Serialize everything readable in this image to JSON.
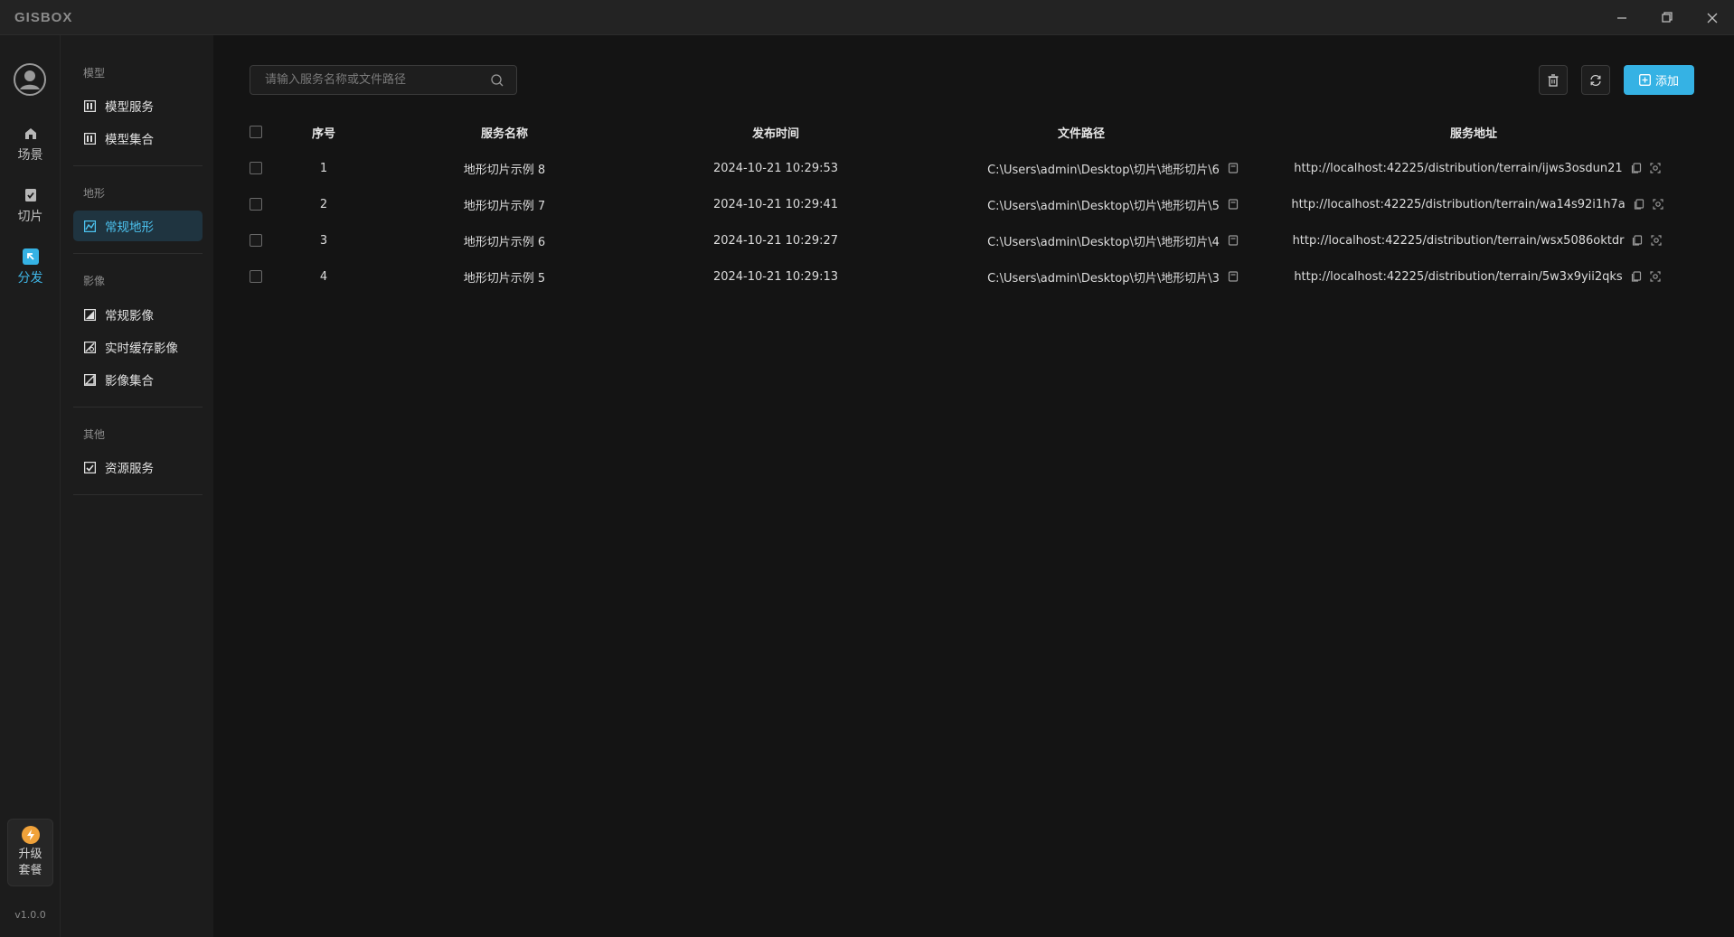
{
  "app": {
    "logo": "GISBOX",
    "version": "v1.0.0"
  },
  "window_controls": {
    "minimize_icon": "minimize-icon",
    "restore_icon": "restore-icon",
    "close_icon": "close-icon"
  },
  "rail": {
    "items": [
      {
        "label": "场景",
        "icon": "scene-icon",
        "active": false
      },
      {
        "label": "切片",
        "icon": "slice-icon",
        "active": false
      },
      {
        "label": "分发",
        "icon": "distribute-icon",
        "active": true
      }
    ],
    "upgrade": {
      "line1": "升级",
      "line2": "套餐"
    }
  },
  "subnav": {
    "groups": [
      {
        "title": "模型",
        "items": [
          {
            "label": "模型服务"
          },
          {
            "label": "模型集合"
          }
        ]
      },
      {
        "title": "地形",
        "items": [
          {
            "label": "常规地形",
            "active": true
          }
        ]
      },
      {
        "title": "影像",
        "items": [
          {
            "label": "常规影像"
          },
          {
            "label": "实时缓存影像"
          },
          {
            "label": "影像集合"
          }
        ]
      },
      {
        "title": "其他",
        "items": [
          {
            "label": "资源服务"
          }
        ]
      }
    ]
  },
  "search": {
    "placeholder": "请输入服务名称或文件路径",
    "value": ""
  },
  "toolbar": {
    "add_label": "添加"
  },
  "colors": {
    "accent": "#35b2e4",
    "active_text": "#4cc3f0",
    "background": "#141414"
  },
  "table": {
    "headers": {
      "index": "序号",
      "name": "服务名称",
      "time": "发布时间",
      "path": "文件路径",
      "url": "服务地址"
    },
    "rows": [
      {
        "index": "1",
        "name": "地形切片示例 8",
        "time": "2024-10-21 10:29:53",
        "path": "C:\\Users\\admin\\Desktop\\切片\\地形切片\\6",
        "url": "http://localhost:42225/distribution/terrain/ijws3osdun21"
      },
      {
        "index": "2",
        "name": "地形切片示例 7",
        "time": "2024-10-21 10:29:41",
        "path": "C:\\Users\\admin\\Desktop\\切片\\地形切片\\5",
        "url": "http://localhost:42225/distribution/terrain/wa14s92i1h7a"
      },
      {
        "index": "3",
        "name": "地形切片示例 6",
        "time": "2024-10-21 10:29:27",
        "path": "C:\\Users\\admin\\Desktop\\切片\\地形切片\\4",
        "url": "http://localhost:42225/distribution/terrain/wsx5086oktdr"
      },
      {
        "index": "4",
        "name": "地形切片示例 5",
        "time": "2024-10-21 10:29:13",
        "path": "C:\\Users\\admin\\Desktop\\切片\\地形切片\\3",
        "url": "http://localhost:42225/distribution/terrain/5w3x9yii2qks"
      }
    ]
  }
}
